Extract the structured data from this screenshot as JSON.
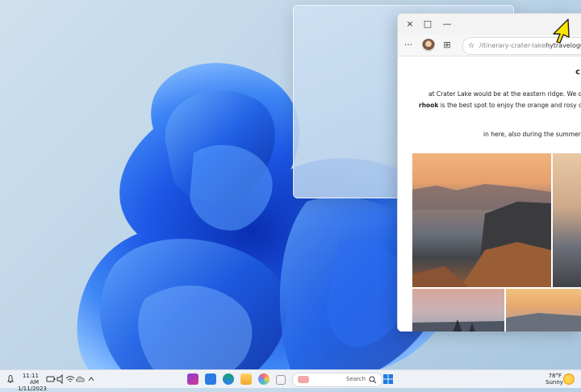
{
  "window_controls": {
    "close": "×",
    "maximize": "□",
    "minimize": "—"
  },
  "browser": {
    "toolbar": {
      "more": "···",
      "favorite": "☆",
      "collections": "⊞"
    },
    "address": {
      "domain": "hytravelogue.com",
      "path": "/itinerary-crater-lake"
    },
    "content": {
      "heading_char": "c",
      "line1": "at Crater Lake would be at the eastern ridge. We drove to",
      "line2_bold": "rhook",
      "line2_rest": " is the best spot to enjoy the orange and rosy colours at",
      "line3": "in here, also during the summer days!"
    }
  },
  "taskbar": {
    "time": "11:11 AM",
    "date": "1/11/2023",
    "search_label": "Search",
    "weather_temp": "78°F",
    "weather_desc": "Sunny"
  },
  "colors": {
    "wallpaper_blue": "#1a5be0",
    "browser_bg": "#ffffff",
    "taskbar_bg": "#eef2f7",
    "cursor_yellow": "#ffe600"
  },
  "icons": [
    "chevron-up-icon",
    "cloud-icon",
    "wifi-icon",
    "speaker-icon",
    "battery-icon",
    "bell-icon",
    "start-icon",
    "search-icon",
    "task-view-icon",
    "copilot-icon",
    "edge-icon",
    "file-explorer-icon",
    "store-icon",
    "mail-icon",
    "weather-icon"
  ]
}
